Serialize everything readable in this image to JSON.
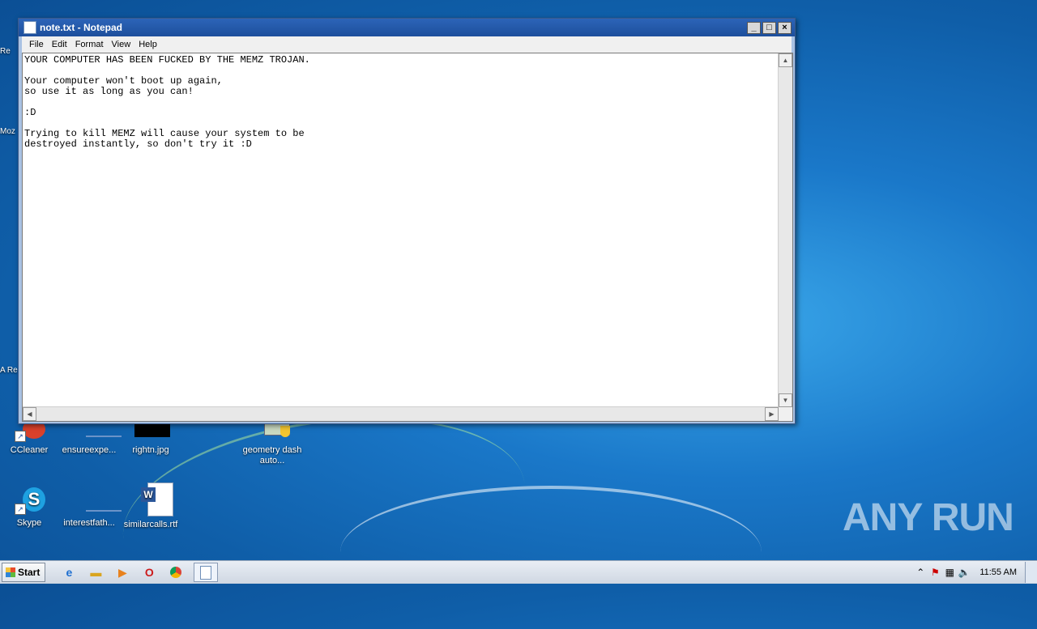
{
  "window": {
    "title": "note.txt - Notepad",
    "buttons": {
      "minimize": "_",
      "maximize": "□",
      "close": "×"
    },
    "menu": [
      "File",
      "Edit",
      "Format",
      "View",
      "Help"
    ],
    "text": "YOUR COMPUTER HAS BEEN FUCKED BY THE MEMZ TROJAN.\n\nYour computer won't boot up again,\nso use it as long as you can!\n\n:D\n\nTrying to kill MEMZ will cause your system to be\ndestroyed instantly, so don't try it :D"
  },
  "desktop": {
    "icons": [
      {
        "label": "CCleaner",
        "icon": "ccleaner-icon"
      },
      {
        "label": "ensureexpe...",
        "icon": "file-icon"
      },
      {
        "label": "rightn.jpg",
        "icon": "image-icon"
      },
      {
        "label": "geometry dash auto...",
        "icon": "installer-icon"
      },
      {
        "label": "Skype",
        "icon": "skype-icon"
      },
      {
        "label": "interestfath...",
        "icon": "file-icon"
      },
      {
        "label": "similarcalls.rtf",
        "icon": "word-document-icon"
      }
    ],
    "edge_labels": [
      "Re",
      "Moz",
      "A Re"
    ]
  },
  "taskbar": {
    "start_label": "Start",
    "pinned": [
      "internet-explorer-icon",
      "explorer-folder-icon",
      "media-player-icon",
      "opera-icon",
      "chrome-icon",
      "notepad-icon"
    ],
    "clock": "11:55 AM"
  },
  "watermark": "ANY RUN"
}
